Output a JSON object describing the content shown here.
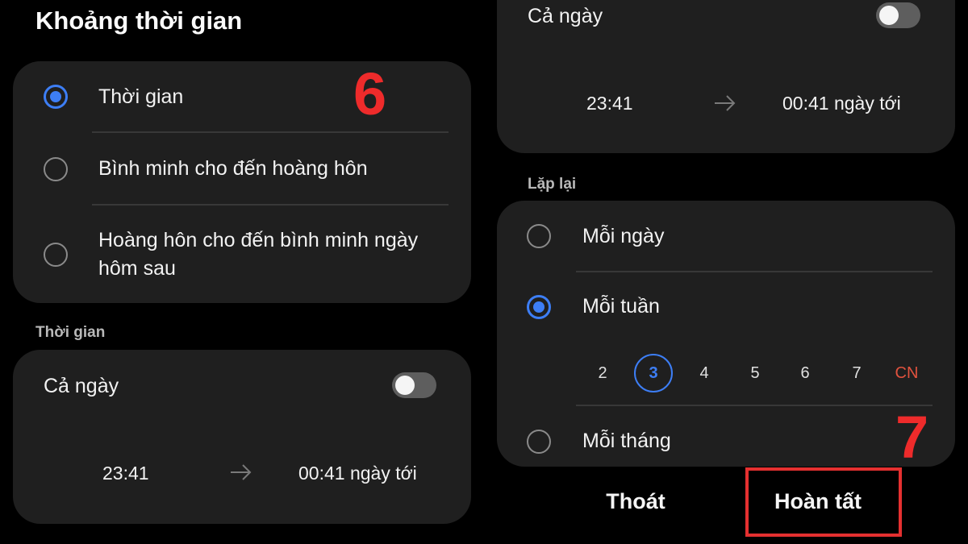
{
  "left": {
    "title": "Khoảng thời gian",
    "options": [
      {
        "label": "Thời gian",
        "checked": true
      },
      {
        "label": "Bình minh cho đến hoàng hôn",
        "checked": false
      },
      {
        "label": "Hoàng hôn cho đến bình minh ngày hôm sau",
        "checked": false
      }
    ],
    "step_label": "6",
    "time_section_label": "Thời gian",
    "all_day_label": "Cả ngày",
    "all_day_on": false,
    "start_time": "23:41",
    "end_time": "00:41 ngày tới"
  },
  "right": {
    "all_day_label": "Cả ngày",
    "all_day_on": false,
    "start_time": "23:41",
    "end_time": "00:41 ngày tới",
    "repeat_section_label": "Lặp lại",
    "repeat_options": [
      {
        "label": "Mỗi ngày",
        "checked": false
      },
      {
        "label": "Mỗi tuần",
        "checked": true
      },
      {
        "label": "Mỗi tháng",
        "checked": false
      }
    ],
    "weekdays": [
      "2",
      "3",
      "4",
      "5",
      "6",
      "7",
      "CN"
    ],
    "selected_weekday": "3",
    "step_label": "7",
    "exit_label": "Thoát",
    "done_label": "Hoàn tất"
  },
  "colors": {
    "accent": "#3d7ef5",
    "annotation": "#ee2b2b",
    "sunday": "#e0523e",
    "card": "#1f1f1f",
    "background": "#000000"
  },
  "icons": [
    "radio-button",
    "toggle-switch",
    "arrow-right-icon"
  ]
}
